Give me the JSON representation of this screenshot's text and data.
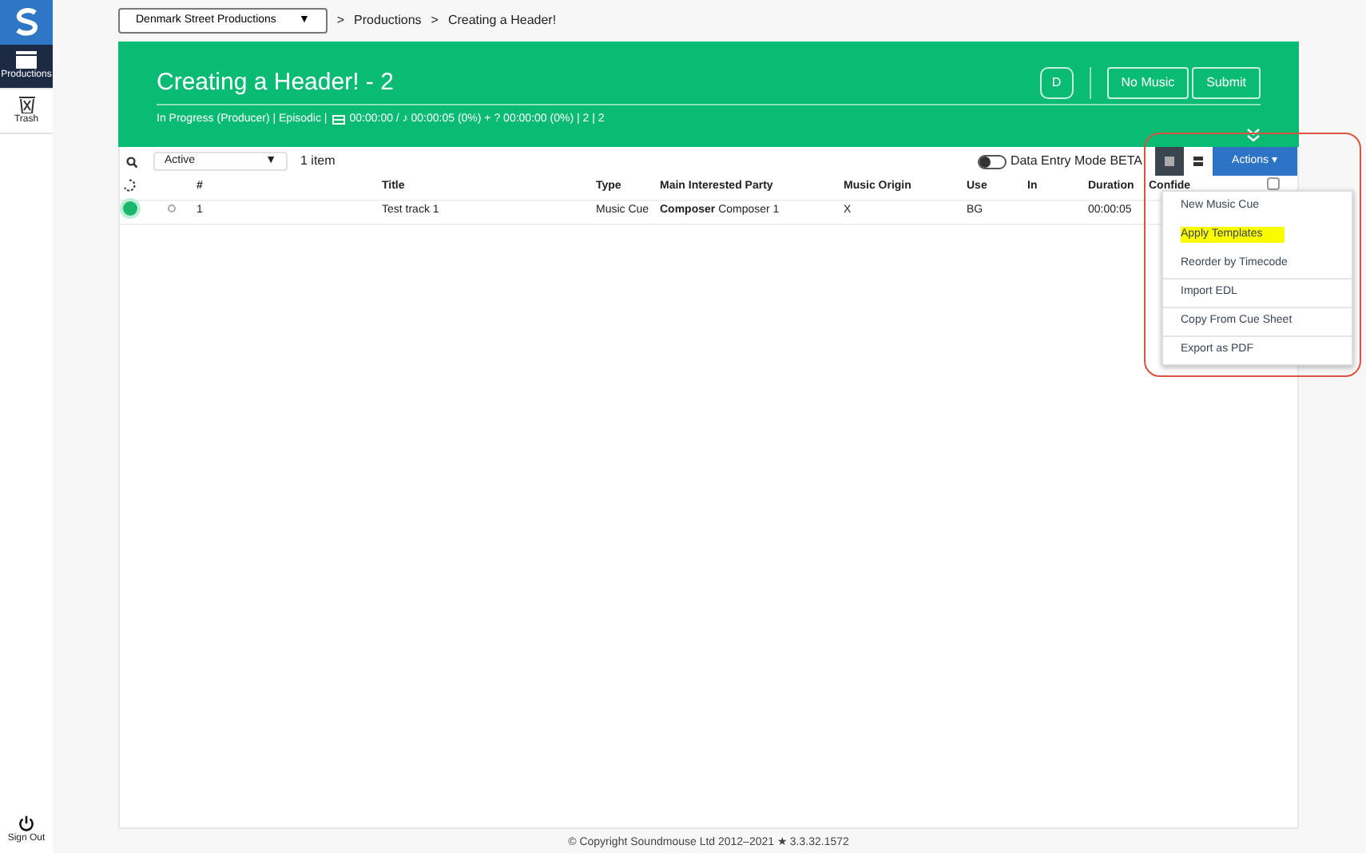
{
  "sidebar": {
    "items": [
      {
        "label": "Productions",
        "kind": "clapper",
        "selected": true
      },
      {
        "label": "Trash",
        "kind": "trash",
        "selected": false
      }
    ],
    "sign_out": "Sign Out"
  },
  "breadcrumb": {
    "company": "Denmark Street Productions",
    "company_caret": "▼",
    "separator": ">",
    "path": [
      "Productions",
      "Creating a Header!"
    ]
  },
  "header": {
    "title": "Creating a Header! - 2",
    "buttons": [
      {
        "label": "D",
        "kind": "square"
      },
      {
        "label": "No Music",
        "kind": "plain"
      },
      {
        "label": "Submit",
        "kind": "plain"
      }
    ],
    "status_before": "In Progress (Producer) | Episodic |",
    "status_after": "00:00:00 / ♪ 00:00:05 (0%) + ? 00:00:00 (0%) | 2 | 2"
  },
  "toolbar": {
    "filter": "Active",
    "filter_caret": "▼",
    "count": "1 item",
    "data_entry_mode": {
      "label": "Data Entry Mode BETA",
      "on": false
    },
    "view_buttons": [
      {
        "kind": "grid",
        "selected": true
      },
      {
        "kind": "rows",
        "selected": false
      }
    ],
    "actions": "Actions ▾"
  },
  "table": {
    "columns": [
      "#",
      "Title",
      "Type",
      "Main Interested Party",
      "Music Origin",
      "Use",
      "In",
      "Duration",
      "Confide"
    ],
    "select_all_checked": false,
    "rows": [
      {
        "color": "#19b86c",
        "selected": false,
        "cells": [
          "1",
          "Test track 1",
          "Music Cue",
          "",
          "X",
          "BG",
          "",
          "00:00:05"
        ],
        "party_role": "Composer",
        "party_name": "Composer 1"
      }
    ]
  },
  "menu": {
    "items": [
      {
        "label": "New Music Cue",
        "highlighted": false,
        "divider_before": false
      },
      {
        "label": "Apply Templates",
        "highlighted": true,
        "divider_before": false
      },
      {
        "label": "Reorder by Timecode",
        "highlighted": false,
        "divider_before": false
      },
      {
        "label": "Import EDL",
        "highlighted": false,
        "divider_before": true
      },
      {
        "label": "Copy From Cue Sheet",
        "highlighted": false,
        "divider_before": true
      },
      {
        "label": "Export as PDF",
        "highlighted": false,
        "divider_before": true
      }
    ]
  },
  "footer": {
    "copyright_sign": "©",
    "link": "Copyright",
    "text": "Soundmouse Ltd 2012–2021 ★ 3.3.32.1572"
  }
}
